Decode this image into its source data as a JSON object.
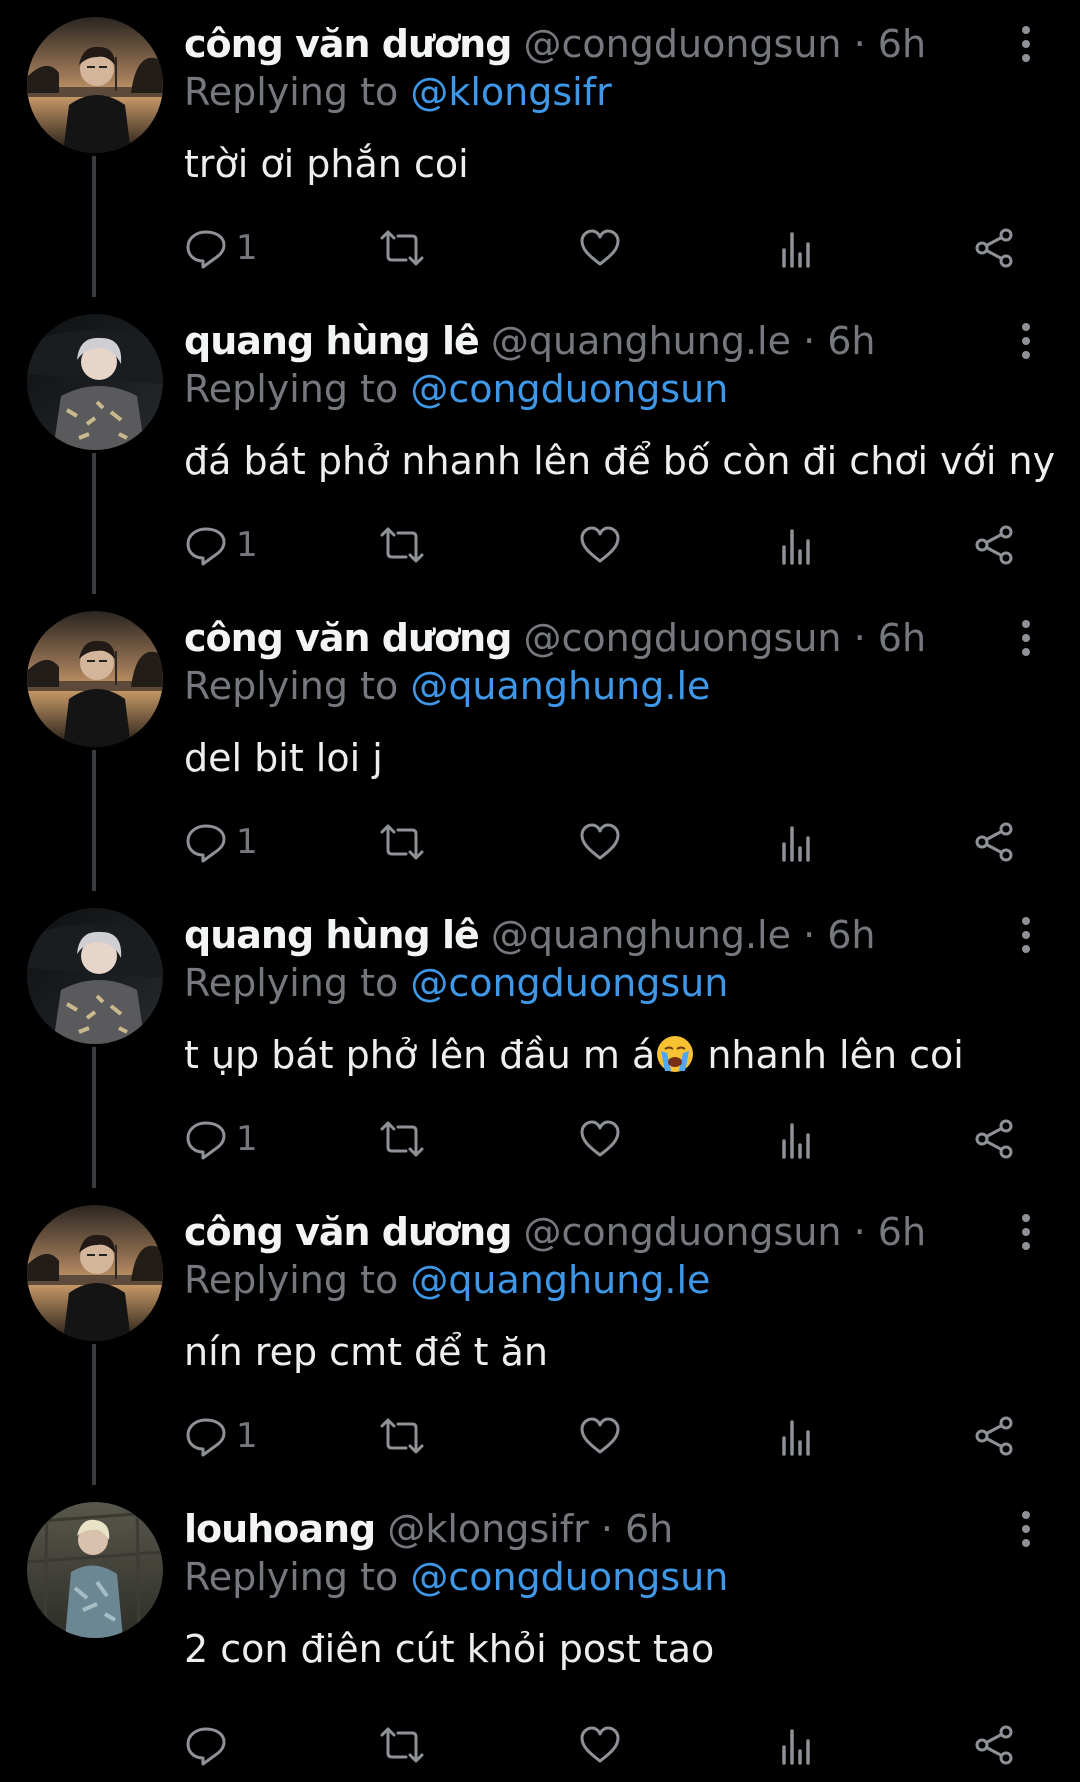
{
  "icons": {
    "reply": "reply-icon",
    "retweet": "retweet-icon",
    "like": "heart-icon",
    "views": "views-icon",
    "share": "share-icon",
    "more": "more-vertical-icon",
    "emoji": "crying-face-emoji"
  },
  "colors": {
    "background": "#000000",
    "mention": "#3e97e7",
    "muted": "#75797e",
    "text": "#eceeef"
  },
  "replies": [
    {
      "name": "công văn dương",
      "handle": "@congduongsun",
      "separator": "·",
      "time": "6h",
      "replying_prefix": "Replying to ",
      "replying_to": "@klongsifr",
      "text": "trời ơi phắn coi",
      "text_after_emoji": "",
      "reply_count": "1"
    },
    {
      "name": "quang hùng lê",
      "handle": "@quanghung.le",
      "separator": "·",
      "time": "6h",
      "replying_prefix": "Replying to ",
      "replying_to": "@congduongsun",
      "text": "đá bát phở nhanh lên để bố còn đi chơi với ny",
      "text_after_emoji": "",
      "reply_count": "1"
    },
    {
      "name": "công văn dương",
      "handle": "@congduongsun",
      "separator": "·",
      "time": "6h",
      "replying_prefix": "Replying to ",
      "replying_to": "@quanghung.le",
      "text": "del bit loi j",
      "text_after_emoji": "",
      "reply_count": "1"
    },
    {
      "name": "quang hùng lê",
      "handle": "@quanghung.le",
      "separator": "·",
      "time": "6h",
      "replying_prefix": "Replying to ",
      "replying_to": "@congduongsun",
      "text": "t ụp bát phở lên đầu m á",
      "text_after_emoji": " nhanh lên coi",
      "reply_count": "1"
    },
    {
      "name": "công văn dương",
      "handle": "@congduongsun",
      "separator": "·",
      "time": "6h",
      "replying_prefix": "Replying to ",
      "replying_to": "@quanghung.le",
      "text": "nín rep cmt để t ăn",
      "text_after_emoji": "",
      "reply_count": "1"
    },
    {
      "name": "louhoang",
      "handle": "@klongsifr",
      "separator": "·",
      "time": "6h",
      "replying_prefix": "Replying to ",
      "replying_to": "@congduongsun",
      "text": "2 con điên cút khỏi post tao",
      "text_after_emoji": "",
      "reply_count": ""
    }
  ]
}
